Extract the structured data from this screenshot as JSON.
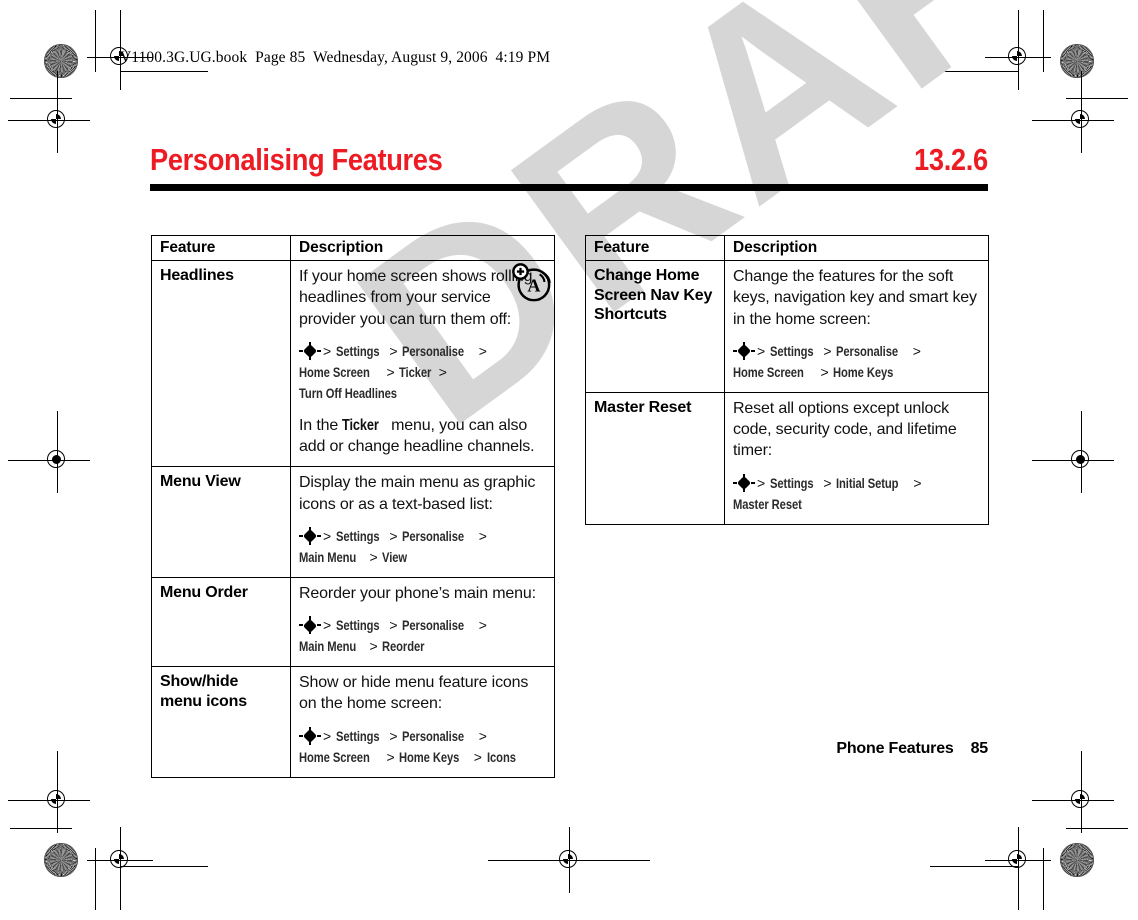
{
  "document": {
    "book_line": "V1100.3G.UG.book  Page 85  Wednesday, August 9, 2006  4:19 PM",
    "title": "Personalising Features",
    "section_number": "13.2.6",
    "watermark": "DRAFT",
    "accent_color": "#ED1C24",
    "watermark_color": "#d6d6d6",
    "footer": "Phone Features    85",
    "footer_label": "Phone Features",
    "footer_page": "85"
  },
  "left_table": {
    "headers": {
      "feature": "Feature",
      "description": "Description"
    },
    "rows": [
      {
        "feature": "Headlines",
        "para1": "If your home screen shows rolling headlines from your service provider you can turn them off:",
        "path": {
          "items": [
            "Settings",
            "Personalise",
            "Home Screen",
            "Ticker",
            "Turn Off Headlines"
          ]
        },
        "para2_before": "In the ",
        "para2_key": "Ticker",
        "para2_after": " menu, you can also add or change headline channels.",
        "icon": "headline-a-icon"
      },
      {
        "feature": "Menu View",
        "para1": "Display the main menu as graphic icons or as a text-based list:",
        "path": {
          "items": [
            "Settings",
            "Personalise",
            "Main Menu",
            "View"
          ]
        }
      },
      {
        "feature": "Menu Order",
        "para1": "Reorder your phone’s main menu:",
        "path": {
          "items": [
            "Settings",
            "Personalise",
            "Main Menu",
            "Reorder"
          ]
        }
      },
      {
        "feature": "Show/hide menu icons",
        "para1": "Show or hide menu feature icons on the home screen:",
        "path": {
          "items": [
            "Settings",
            "Personalise",
            "Home Screen",
            "Home Keys",
            "Icons"
          ]
        }
      }
    ]
  },
  "right_table": {
    "headers": {
      "feature": "Feature",
      "description": "Description"
    },
    "rows": [
      {
        "feature": "Change Home Screen Nav Key Shortcuts",
        "para1": "Change the features for the soft keys, navigation key and smart key in the home screen:",
        "path": {
          "items": [
            "Settings",
            "Personalise",
            "Home Screen",
            "Home Keys"
          ]
        }
      },
      {
        "feature": "Master Reset",
        "para1": "Reset all options except unlock code, security code, and lifetime timer:",
        "path": {
          "items": [
            "Settings",
            "Initial Setup",
            "Master Reset"
          ]
        }
      }
    ]
  }
}
